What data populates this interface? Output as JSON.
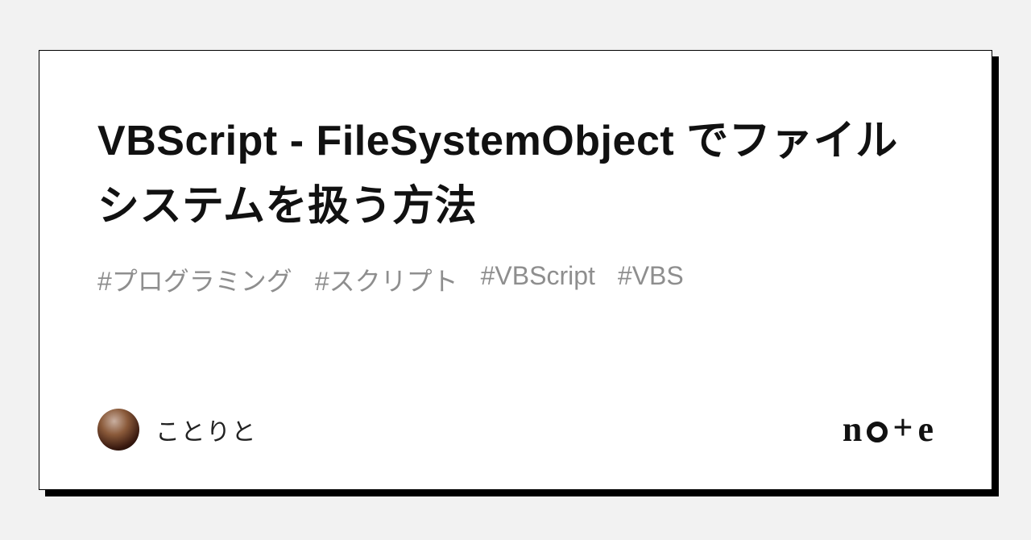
{
  "card": {
    "title": "VBScript - FileSystemObject でファイルシステムを扱う方法",
    "tags": [
      "#プログラミング",
      "#スクリプト",
      "#VBScript",
      "#VBS"
    ],
    "author": {
      "name": "ことりと"
    },
    "brand": {
      "letters": [
        "n",
        "o",
        "t",
        "e"
      ]
    }
  }
}
